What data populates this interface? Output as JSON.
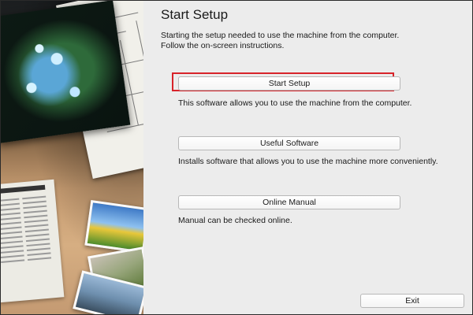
{
  "window": {
    "title": "Start Setup",
    "intro_line1": "Starting the setup needed to use the machine from the computer.",
    "intro_line2": "Follow the on-screen instructions."
  },
  "options": [
    {
      "button_label": "Start Setup",
      "description": "This software allows you to use the machine from the computer.",
      "highlighted": true
    },
    {
      "button_label": "Useful Software",
      "description": "Installs software that allows you to use the machine more conveniently.",
      "highlighted": false
    },
    {
      "button_label": "Online Manual",
      "description": "Manual can be checked online.",
      "highlighted": false
    }
  ],
  "footer": {
    "exit_label": "Exit"
  },
  "colors": {
    "highlight_border": "#d8232a",
    "panel_background": "#ececec"
  }
}
